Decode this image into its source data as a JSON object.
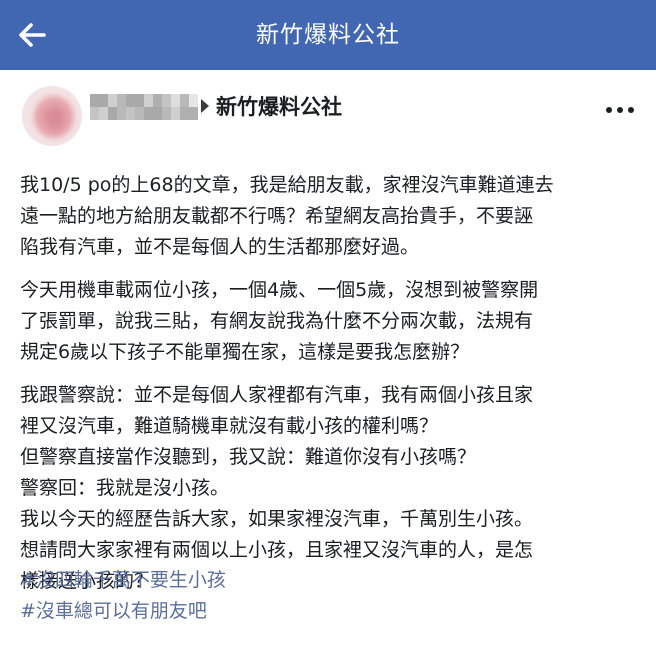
{
  "topbar": {
    "title": "新竹爆料公社",
    "back_icon": "arrow-left-icon"
  },
  "post": {
    "group_name": "新竹爆料公社",
    "more_icon": "ellipsis-icon",
    "paragraphs": [
      [
        "我10/5 po的上68的文章，我是給朋友載，家裡沒汽車難道連去",
        "遠一點的地方給朋友載都不行嗎？希望網友高抬貴手，不要誣",
        "陷我有汽車，並不是每個人的生活都那麼好過。"
      ],
      [
        "今天用機車載兩位小孩，一個4歲、一個5歲，沒想到被警察開",
        "了張罰單，說我三貼，有網友說我為什麼不分兩次載，法規有",
        "規定6歲以下孩子不能單獨在家，這樣是要我怎麼辦？"
      ],
      [
        "我跟警察說：並不是每個人家裡都有汽車，我有兩個小孩且家",
        "裡又沒汽車，難道騎機車就沒有載小孩的權利嗎？",
        "但警察直接當作沒聽到，我又說：難道你沒有小孩嗎？",
        "警察回：我就是沒小孩。",
        "我以今天的經歷告訴大家，如果家裡沒汽車，千萬別生小孩。",
        "想請問大家家裡有兩個以上小孩，且家裡又沒汽車的人，是怎",
        "樣接送小孩的？"
      ]
    ],
    "hashtags": [
      "#沒四輪千萬不要生小孩",
      "#沒車總可以有朋友吧"
    ]
  },
  "colors": {
    "topbar_bg": "#4267b2",
    "hashtag": "#5b6f9c",
    "text": "#1c1e21"
  }
}
